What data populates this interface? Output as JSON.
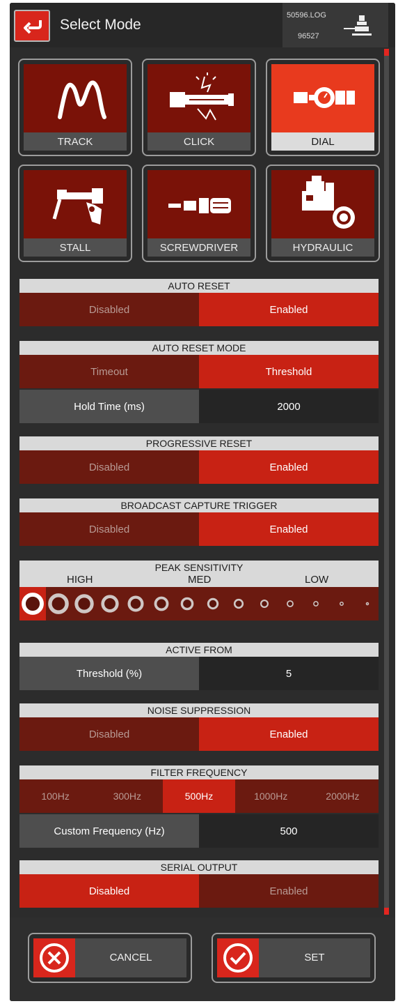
{
  "header": {
    "title": "Select Mode",
    "log_file": "50596.LOG",
    "log_id": "96527"
  },
  "modes": [
    {
      "label": "TRACK",
      "icon": "track-curve-icon",
      "active": false
    },
    {
      "label": "CLICK",
      "icon": "click-wrench-icon",
      "active": false
    },
    {
      "label": "DIAL",
      "icon": "dial-wrench-icon",
      "active": true
    },
    {
      "label": "STALL",
      "icon": "stall-tool-icon",
      "active": false
    },
    {
      "label": "SCREWDRIVER",
      "icon": "screwdriver-icon",
      "active": false
    },
    {
      "label": "HYDRAULIC",
      "icon": "hydraulic-tool-icon",
      "active": false
    }
  ],
  "auto_reset": {
    "title": "AUTO RESET",
    "options": [
      "Disabled",
      "Enabled"
    ],
    "selected": "Enabled"
  },
  "auto_reset_mode": {
    "title": "AUTO RESET MODE",
    "options": [
      "Timeout",
      "Threshold"
    ],
    "selected": "Threshold",
    "field_label": "Hold Time (ms)",
    "field_value": "2000"
  },
  "progressive_reset": {
    "title": "PROGRESSIVE RESET",
    "options": [
      "Disabled",
      "Enabled"
    ],
    "selected": "Enabled"
  },
  "broadcast_capture_trigger": {
    "title": "BROADCAST CAPTURE TRIGGER",
    "options": [
      "Disabled",
      "Enabled"
    ],
    "selected": "Enabled"
  },
  "peak_sensitivity": {
    "title": "PEAK SENSITIVITY",
    "high": "HIGH",
    "med": "MED",
    "low": "LOW",
    "levels": 14,
    "selected_index": 0
  },
  "active_from": {
    "title": "ACTIVE FROM",
    "field_label": "Threshold (%)",
    "field_value": "5"
  },
  "noise_suppression": {
    "title": "NOISE SUPPRESSION",
    "options": [
      "Disabled",
      "Enabled"
    ],
    "selected": "Enabled"
  },
  "filter_frequency": {
    "title": "FILTER FREQUENCY",
    "options": [
      "100Hz",
      "300Hz",
      "500Hz",
      "1000Hz",
      "2000Hz"
    ],
    "selected": "500Hz",
    "field_label": "Custom Frequency (Hz)",
    "field_value": "500"
  },
  "serial_output": {
    "title": "SERIAL OUTPUT",
    "options": [
      "Disabled",
      "Enabled"
    ],
    "selected": "Disabled"
  },
  "footer": {
    "cancel_label": "CANCEL",
    "set_label": "SET"
  },
  "colors": {
    "accent": "#d8261c",
    "dark_red": "#6b1a10",
    "active_red": "#c82214"
  }
}
